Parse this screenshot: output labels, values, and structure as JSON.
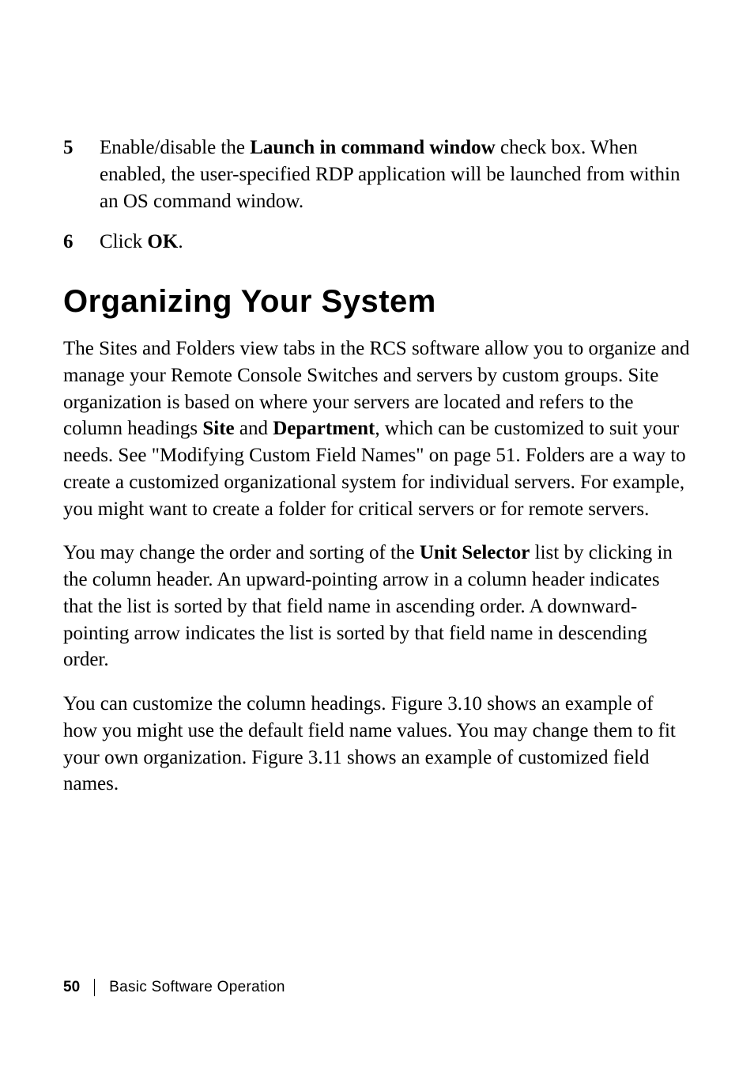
{
  "list": [
    {
      "marker": "5",
      "pre": "Enable/disable the ",
      "bold1": "Launch in command window",
      "post": " check box. When enabled, the user-specified RDP application will be launched from within an OS command window."
    },
    {
      "marker": "6",
      "pre": "Click ",
      "bold1": "OK",
      "post": "."
    }
  ],
  "heading": "Organizing Your System",
  "para1": {
    "t1": "The Sites and Folders view tabs in the RCS software allow you to organize and manage your Remote Console Switches and servers by custom groups. Site organization is based on where your servers are located and refers to the column headings ",
    "b1": "Site",
    "t2": " and ",
    "b2": "Department",
    "t3": ", which can be customized to suit your needs. See \"Modifying Custom Field Names\" on page 51. Folders are a way to create a customized organizational system for individual servers. For example, you might want to create a folder for critical servers or for remote servers."
  },
  "para2": {
    "t1": "You may change the order and sorting of the ",
    "b1": "Unit Selector",
    "t2": " list by clicking in the column header. An upward-pointing arrow in a column header indicates that the list is sorted by that field name in ascending order. A downward-pointing arrow indicates the list is sorted by that field name in descending order."
  },
  "para3": "You can customize the column headings. Figure 3.10 shows an example of how you might use the default field name values. You may change them to fit your own organization. Figure 3.11 shows an example of customized field names.",
  "footer": {
    "page": "50",
    "chapter": "Basic Software Operation"
  }
}
